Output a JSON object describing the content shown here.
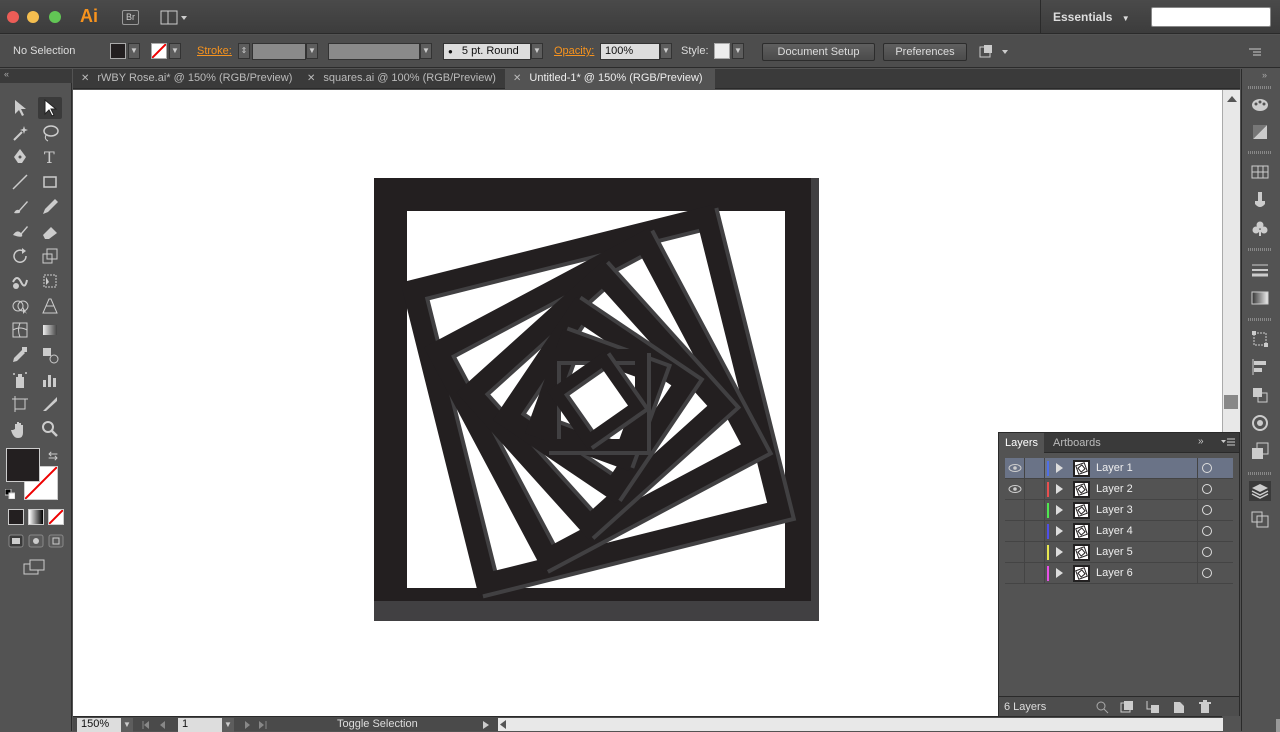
{
  "app": {
    "logo": "Ai",
    "bridge_label": "Br",
    "workspace": "Essentials",
    "search_placeholder": ""
  },
  "control_bar": {
    "selection": "No Selection",
    "stroke_label": "Stroke:",
    "brush": "5 pt. Round",
    "opacity_label": "Opacity:",
    "opacity_value": "100%",
    "style_label": "Style:",
    "document_setup": "Document Setup",
    "preferences": "Preferences"
  },
  "tabs": [
    {
      "label": "rWBY Rose.ai* @ 150% (RGB/Preview)",
      "active": false
    },
    {
      "label": "squares.ai @ 100% (RGB/Preview)",
      "active": false
    },
    {
      "label": "Untitled-1* @ 150% (RGB/Preview)",
      "active": true
    }
  ],
  "tools": [
    "selection-tool-icon",
    "direct-selection-tool-icon",
    "magic-wand-tool-icon",
    "lasso-tool-icon",
    "pen-tool-icon",
    "type-tool-icon",
    "line-tool-icon",
    "rectangle-tool-icon",
    "paintbrush-tool-icon",
    "pencil-tool-icon",
    "blob-brush-tool-icon",
    "eraser-tool-icon",
    "rotate-tool-icon",
    "scale-tool-icon",
    "warp-tool-icon",
    "free-transform-tool-icon",
    "shape-builder-tool-icon",
    "perspective-grid-tool-icon",
    "mesh-tool-icon",
    "gradient-tool-icon",
    "eyedropper-tool-icon",
    "blend-tool-icon",
    "symbol-sprayer-tool-icon",
    "column-graph-tool-icon",
    "artboard-tool-icon",
    "slice-tool-icon",
    "hand-tool-icon",
    "zoom-tool-icon"
  ],
  "colors": {
    "accent": "#f7931e",
    "artwork_dark": "#231f20",
    "artwork_gray": "#414042",
    "layer_selected": "#6a7387"
  },
  "layers_panel": {
    "tab_layers": "Layers",
    "tab_artboards": "Artboards",
    "count": "6 Layers",
    "layers": [
      {
        "name": "Layer 1",
        "color": "#4f6fe8",
        "visible": true,
        "selected": true
      },
      {
        "name": "Layer 2",
        "color": "#e84f4f",
        "visible": true,
        "selected": false
      },
      {
        "name": "Layer 3",
        "color": "#4fe84f",
        "visible": false,
        "selected": false
      },
      {
        "name": "Layer 4",
        "color": "#4f4fe8",
        "visible": false,
        "selected": false
      },
      {
        "name": "Layer 5",
        "color": "#e8e84f",
        "visible": false,
        "selected": false
      },
      {
        "name": "Layer 6",
        "color": "#e84fe8",
        "visible": false,
        "selected": false
      }
    ]
  },
  "status_bar": {
    "zoom": "150%",
    "artboard_number": "1",
    "toggle": "Toggle Selection"
  }
}
